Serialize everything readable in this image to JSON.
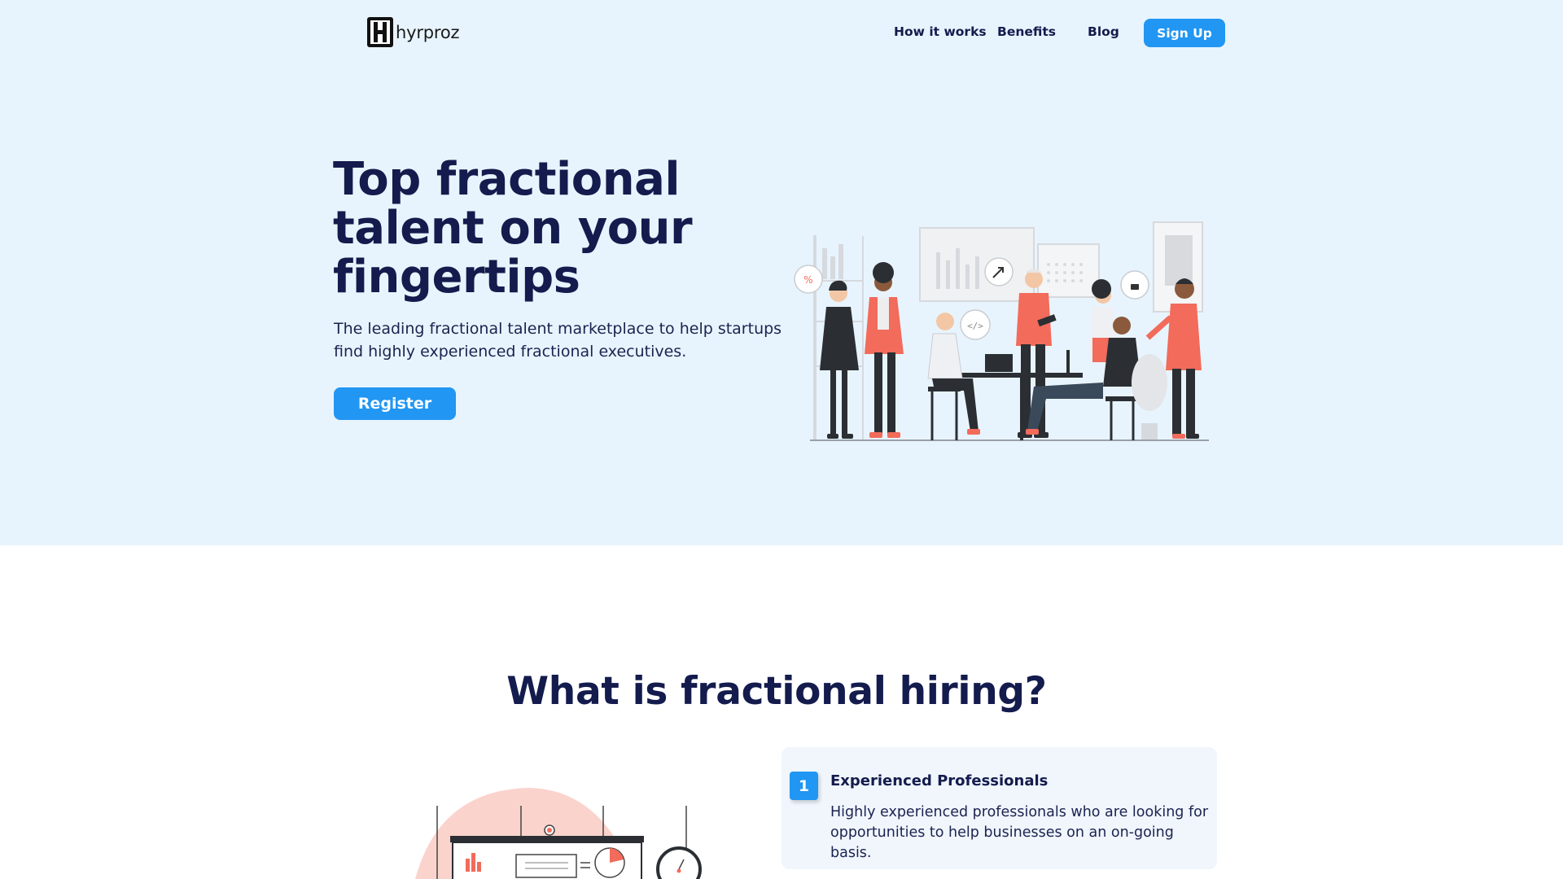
{
  "brand": {
    "name": "hyrproz"
  },
  "nav": [
    {
      "label": "How it works"
    },
    {
      "label": "Benefits"
    },
    {
      "label": "Blog"
    }
  ],
  "header": {
    "signup_label": "Sign Up"
  },
  "hero": {
    "title": "Top fractional talent on your fingertips",
    "subtitle": "The leading fractional talent marketplace to help startups find highly experienced fractional executives.",
    "cta_label": "Register",
    "badges": [
      "%"
    ]
  },
  "section": {
    "title": "What is fractional hiring?",
    "features": [
      {
        "number": "1",
        "title": "Experienced Professionals",
        "description": "Highly experienced professionals who are looking for opportunities to help businesses on an on-going basis."
      }
    ]
  },
  "colors": {
    "hero_bg": "#e8f4fd",
    "accent": "#2196f3",
    "heading": "#141b4d",
    "illustration_accent": "#f26b5b"
  }
}
